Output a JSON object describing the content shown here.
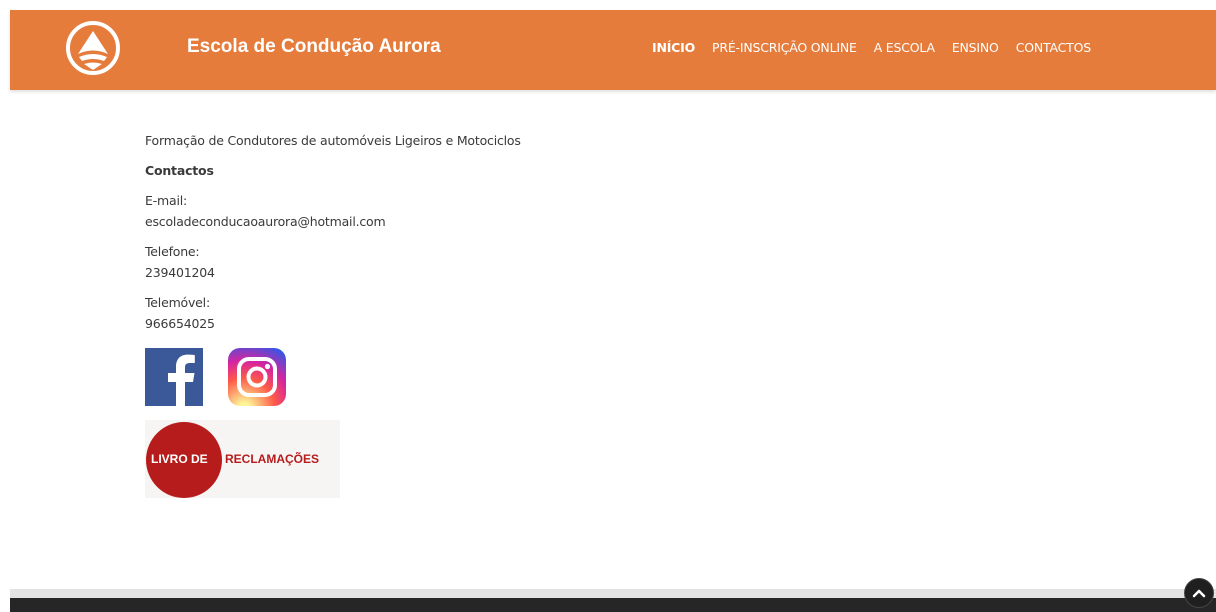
{
  "header": {
    "brand": "Escola de Condução Aurora",
    "logo_icon": "aurora-logo-icon",
    "accent_color": "#E67C3B"
  },
  "nav": {
    "items": [
      {
        "label": "INÍCIO",
        "active": true
      },
      {
        "label": "PRÉ-INSCRIÇÃO ONLINE",
        "active": false
      },
      {
        "label": "A ESCOLA",
        "active": false
      },
      {
        "label": "ENSINO",
        "active": false
      },
      {
        "label": "CONTACTOS",
        "active": false
      }
    ]
  },
  "content": {
    "intro": "Formação de Condutores de automóveis Ligeiros e Motociclos",
    "contacts_heading": "Contactos",
    "email_label": "E-mail:",
    "email_value": "escoladeconducaoaurora@hotmail.com",
    "phone_label": "Telefone:",
    "phone_value": "239401204",
    "mobile_label": "Telemóvel:",
    "mobile_value": "966654025"
  },
  "social": {
    "facebook_icon": "facebook-icon",
    "instagram_icon": "instagram-icon"
  },
  "livro_reclamacoes": {
    "part1": "LIVRO DE",
    "part2": "RECLAMAÇÕES",
    "color": "#B71C1C"
  },
  "back_to_top_icon": "chevron-up-icon"
}
